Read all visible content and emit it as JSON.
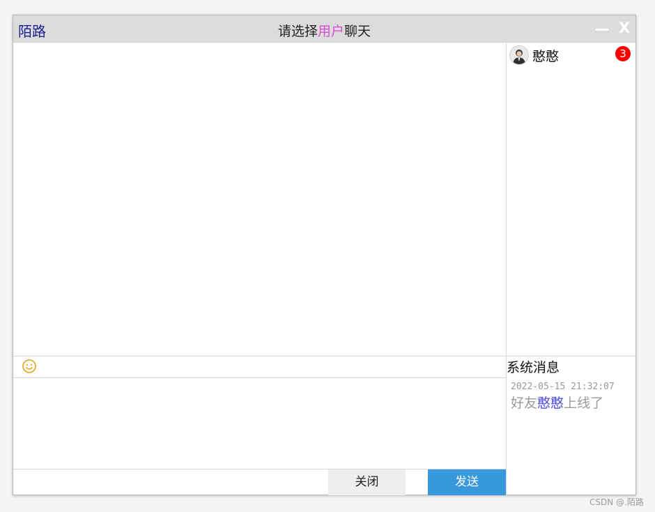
{
  "window": {
    "app_name": "陌路",
    "title_prefix": "请选择",
    "title_highlight": "用户",
    "title_suffix": "聊天",
    "close_label": "X"
  },
  "users": [
    {
      "name": "憨憨",
      "unread": "3",
      "avatar_icon": "user-avatar"
    }
  ],
  "composer": {
    "emoji_icon": "smiley-icon",
    "close_label": "关闭",
    "send_label": "发送"
  },
  "system": {
    "title": "系统消息",
    "messages": [
      {
        "time": "2022-05-15 21:32:07",
        "prefix": "好友",
        "name": "憨憨",
        "suffix": "上线了"
      }
    ]
  },
  "watermark": "CSDN @.陌路",
  "colors": {
    "titlebar": "#dcdcdc",
    "send_button": "#3798db",
    "badge": "#ff0000",
    "title_highlight": "#d44fd4",
    "app_name": "#1d1d8f",
    "friend_name": "#4a4ae0"
  }
}
